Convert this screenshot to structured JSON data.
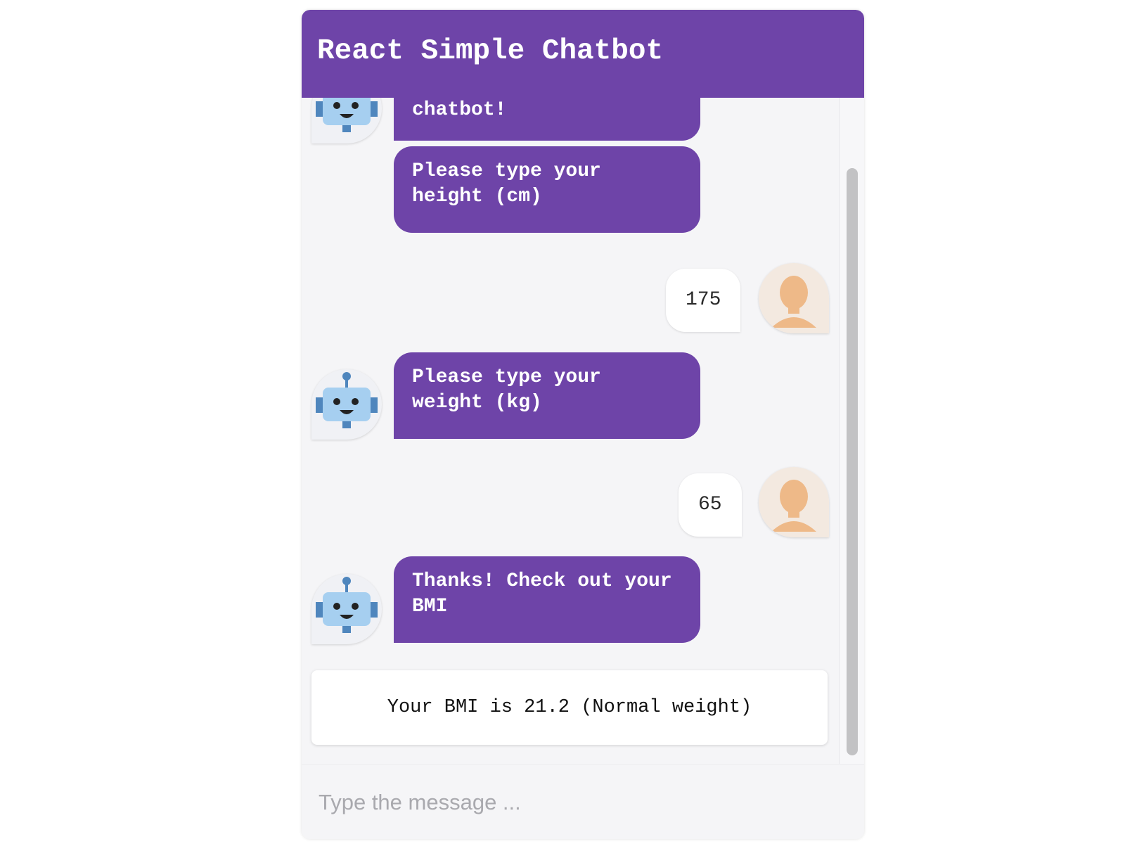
{
  "header": {
    "title": "React Simple Chatbot"
  },
  "messages": [
    {
      "from": "bot",
      "text": "chatbot!"
    },
    {
      "from": "bot",
      "text": "Please type your height (cm)"
    },
    {
      "from": "user",
      "text": "175"
    },
    {
      "from": "bot",
      "text": "Please type your weight (kg)"
    },
    {
      "from": "user",
      "text": "65"
    },
    {
      "from": "bot",
      "text": "Thanks! Check out your BMI"
    }
  ],
  "result": {
    "text": "Your BMI is 21.2 (Normal weight)"
  },
  "footer": {
    "input_placeholder": "Type the message ..."
  },
  "colors": {
    "header_bg": "#6e44a8",
    "bot_bubble": "#6e44a8",
    "user_bubble": "#ffffff",
    "chat_bg": "#f5f5f7"
  },
  "icons": {
    "bot_avatar": "robot-icon",
    "user_avatar": "user-icon"
  }
}
